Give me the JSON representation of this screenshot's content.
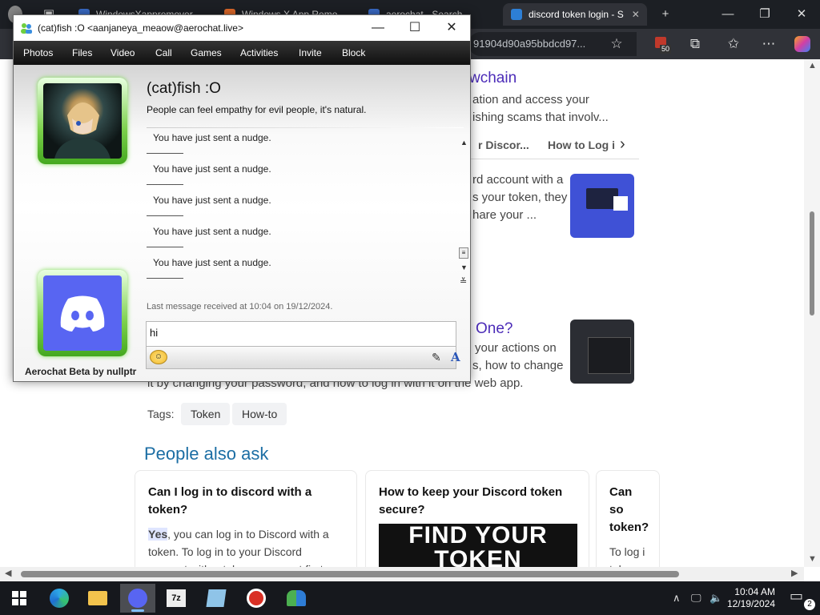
{
  "browser": {
    "tabs": [
      {
        "title": "WindowsXappremover"
      },
      {
        "title": "Windows X App Remo"
      },
      {
        "title": "aerochat - Search"
      },
      {
        "title": "discord token login - S"
      }
    ],
    "new_tab_label": "+",
    "address_partial": "91904d90a95bbdcd97...",
    "badge_count": "50"
  },
  "page": {
    "title_fragment": "wchain",
    "snippet_lines": [
      "ation and access your",
      "ishing scams that involv..."
    ],
    "subtabs": [
      "r Discor...",
      "How to Log i"
    ],
    "result2_lines": [
      "rd account with a",
      "s your token, they",
      "hare your ..."
    ],
    "question_link": "One?",
    "result3_lines": [
      "your actions on",
      "s, how to change"
    ],
    "result3_bottom": "it by changing your password, and how to log in with it on the web app.",
    "tags_label": "Tags:",
    "tags": [
      "Token",
      "How-to"
    ],
    "people_also_ask": "People also ask",
    "paa": [
      {
        "question": "Can I log in to discord with a token?",
        "answer_highlight": "Yes",
        "answer": ", you can log in to Discord with a token. To log in to your Discord account with a token, you must first copy your"
      },
      {
        "question": "How to keep your Discord token secure?",
        "image_text": "FIND YOUR TOKEN"
      },
      {
        "question": "Can so token?",
        "answer": "To log i token, y token"
      }
    ]
  },
  "aerochat": {
    "window_title": "(cat)fish :O <aanjaneya_meaow@aerochat.live>",
    "menu": [
      "Photos",
      "Files",
      "Video",
      "Call",
      "Games",
      "Activities",
      "Invite",
      "Block"
    ],
    "contact_name": "(cat)fish :O",
    "contact_status": "People can feel empathy for evil people, it's natural.",
    "messages": [
      "You have just sent a nudge.",
      "You have just sent a nudge.",
      "You have just sent a nudge.",
      "You have just sent a nudge.",
      "You have just sent a nudge."
    ],
    "last_message": "Last message received at 10:04 on 19/12/2024.",
    "input_value": "hi",
    "footer": "Aerochat Beta by nullptr"
  },
  "taskbar": {
    "apps": [
      "start-icon",
      "edge-icon",
      "file-explorer-icon",
      "aerochat-icon",
      "7zip-icon",
      "notepad-icon",
      "no-entry-icon",
      "people-icon"
    ],
    "time": "10:04 AM",
    "date": "12/19/2024",
    "notification_count": "2"
  },
  "colors": {
    "accent_green": "#6fcf3f",
    "discord_blurple": "#5865f2",
    "link_purple": "#4b2bb8",
    "paa_blue": "#1c6ea4"
  }
}
